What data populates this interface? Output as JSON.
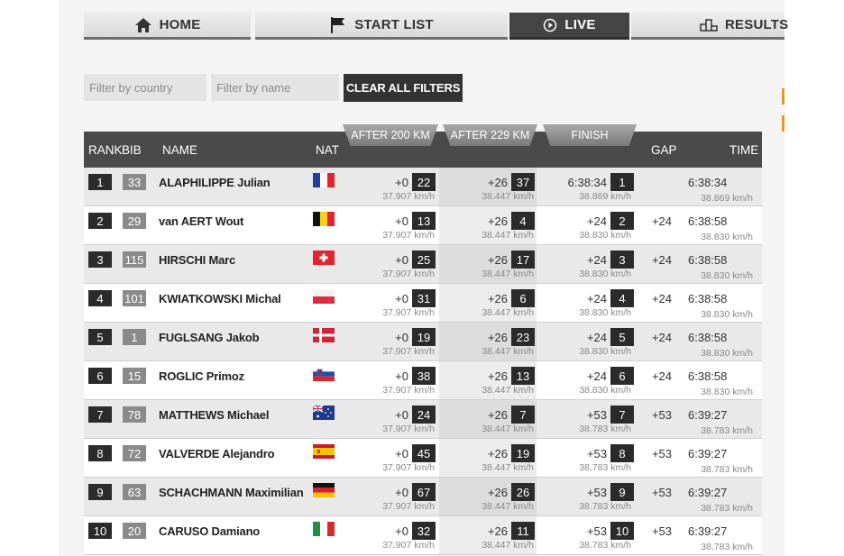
{
  "nav": {
    "home": "HOME",
    "start_list": "START LIST",
    "live": "LIVE",
    "results": "RESULTS"
  },
  "filters": {
    "country_placeholder": "Filter by country",
    "name_placeholder": "Filter by name",
    "clear_label": "CLEAR ALL FILTERS"
  },
  "sections": {
    "s1": "AFTER 200 KM",
    "s2": "AFTER 229 KM",
    "s3": "FINISH"
  },
  "columns": {
    "rank": "RANK",
    "bib": "BIB",
    "name": "NAME",
    "nat": "NAT",
    "gap": "GAP",
    "time": "TIME"
  },
  "colors": {
    "active_tab": "#444444",
    "accent_orange": "#e8962a"
  },
  "riders": [
    {
      "rank": "1",
      "bib": "33",
      "name": "ALAPHILIPPE Julian",
      "nat": "FRA",
      "s1_time": "+0",
      "s1_pos": "22",
      "s1_speed": "37.907 km/h",
      "s2_time": "+26",
      "s2_pos": "37",
      "s2_speed": "38.447 km/h",
      "f_time": "6:38:34",
      "f_pos": "1",
      "f_speed": "38.869 km/h",
      "gap": "",
      "time": "6:38:34",
      "speed": "38.869 km/h"
    },
    {
      "rank": "2",
      "bib": "29",
      "name": "van AERT Wout",
      "nat": "BEL",
      "s1_time": "+0",
      "s1_pos": "13",
      "s1_speed": "37.907 km/h",
      "s2_time": "+26",
      "s2_pos": "4",
      "s2_speed": "38.447 km/h",
      "f_time": "+24",
      "f_pos": "2",
      "f_speed": "38.830 km/h",
      "gap": "+24",
      "time": "6:38:58",
      "speed": "38.830 km/h"
    },
    {
      "rank": "3",
      "bib": "115",
      "name": "HIRSCHI Marc",
      "nat": "SUI",
      "s1_time": "+0",
      "s1_pos": "25",
      "s1_speed": "37.907 km/h",
      "s2_time": "+26",
      "s2_pos": "17",
      "s2_speed": "38.447 km/h",
      "f_time": "+24",
      "f_pos": "3",
      "f_speed": "38.830 km/h",
      "gap": "+24",
      "time": "6:38:58",
      "speed": "38.830 km/h"
    },
    {
      "rank": "4",
      "bib": "101",
      "name": "KWIATKOWSKI Michal",
      "nat": "POL",
      "s1_time": "+0",
      "s1_pos": "31",
      "s1_speed": "37.907 km/h",
      "s2_time": "+26",
      "s2_pos": "6",
      "s2_speed": "38.447 km/h",
      "f_time": "+24",
      "f_pos": "4",
      "f_speed": "38.830 km/h",
      "gap": "+24",
      "time": "6:38:58",
      "speed": "38.830 km/h"
    },
    {
      "rank": "5",
      "bib": "1",
      "name": "FUGLSANG Jakob",
      "nat": "DEN",
      "s1_time": "+0",
      "s1_pos": "19",
      "s1_speed": "37.907 km/h",
      "s2_time": "+26",
      "s2_pos": "23",
      "s2_speed": "38.447 km/h",
      "f_time": "+24",
      "f_pos": "5",
      "f_speed": "38.830 km/h",
      "gap": "+24",
      "time": "6:38:58",
      "speed": "38.830 km/h"
    },
    {
      "rank": "6",
      "bib": "15",
      "name": "ROGLIC Primoz",
      "nat": "SLO",
      "s1_time": "+0",
      "s1_pos": "38",
      "s1_speed": "37.907 km/h",
      "s2_time": "+26",
      "s2_pos": "13",
      "s2_speed": "38.447 km/h",
      "f_time": "+24",
      "f_pos": "6",
      "f_speed": "38.830 km/h",
      "gap": "+24",
      "time": "6:38:58",
      "speed": "38.830 km/h"
    },
    {
      "rank": "7",
      "bib": "78",
      "name": "MATTHEWS Michael",
      "nat": "AUS",
      "s1_time": "+0",
      "s1_pos": "24",
      "s1_speed": "37.907 km/h",
      "s2_time": "+26",
      "s2_pos": "7",
      "s2_speed": "38.447 km/h",
      "f_time": "+53",
      "f_pos": "7",
      "f_speed": "38.783 km/h",
      "gap": "+53",
      "time": "6:39:27",
      "speed": "38.783 km/h"
    },
    {
      "rank": "8",
      "bib": "72",
      "name": "VALVERDE Alejandro",
      "nat": "ESP",
      "s1_time": "+0",
      "s1_pos": "45",
      "s1_speed": "37.907 km/h",
      "s2_time": "+26",
      "s2_pos": "19",
      "s2_speed": "38.447 km/h",
      "f_time": "+53",
      "f_pos": "8",
      "f_speed": "38.783 km/h",
      "gap": "+53",
      "time": "6:39:27",
      "speed": "38.783 km/h"
    },
    {
      "rank": "9",
      "bib": "63",
      "name": "SCHACHMANN Maximilian",
      "nat": "GER",
      "s1_time": "+0",
      "s1_pos": "67",
      "s1_speed": "37.907 km/h",
      "s2_time": "+26",
      "s2_pos": "26",
      "s2_speed": "38.447 km/h",
      "f_time": "+53",
      "f_pos": "9",
      "f_speed": "38.783 km/h",
      "gap": "+53",
      "time": "6:39:27",
      "speed": "38.783 km/h"
    },
    {
      "rank": "10",
      "bib": "20",
      "name": "CARUSO Damiano",
      "nat": "ITA",
      "s1_time": "+0",
      "s1_pos": "32",
      "s1_speed": "37.907 km/h",
      "s2_time": "+26",
      "s2_pos": "11",
      "s2_speed": "38.447 km/h",
      "f_time": "+53",
      "f_pos": "10",
      "f_speed": "38.783 km/h",
      "gap": "+53",
      "time": "6:39:27",
      "speed": "38.783 km/h"
    }
  ]
}
